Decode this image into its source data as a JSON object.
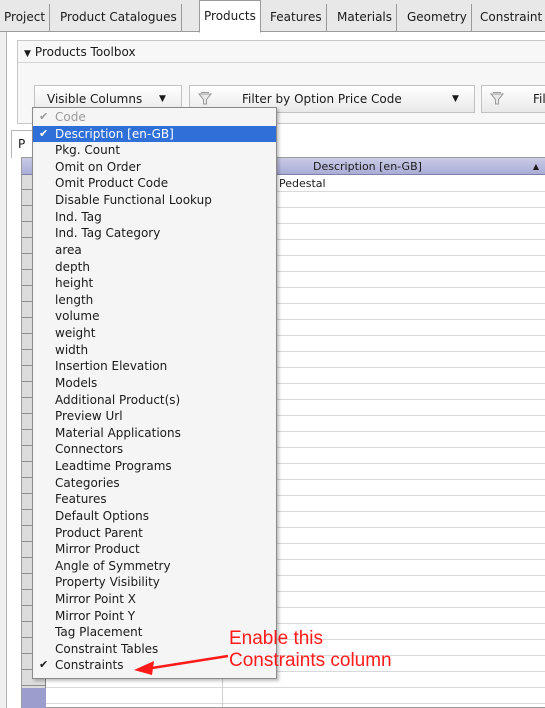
{
  "tabs": [
    "Project",
    "Product Catalogues",
    "Products",
    "Features",
    "Materials",
    "Geometry",
    "Constraint"
  ],
  "toolbox": {
    "title": "Products Toolbox",
    "visible_columns_label": "Visible Columns",
    "filter_price_code_label": "Filter by Option Price Code",
    "filter_truncated_label": "Filt"
  },
  "subtab_label": "P",
  "grid": {
    "column_header": "Description [en-GB]",
    "first_cell": "Pedestal"
  },
  "menu": {
    "items": [
      {
        "label": "Code",
        "checked": true,
        "state": "disabled"
      },
      {
        "label": "Description [en-GB]",
        "checked": true,
        "state": "highlighted"
      },
      {
        "label": "Pkg. Count",
        "checked": false
      },
      {
        "label": "Omit on Order",
        "checked": false
      },
      {
        "label": "Omit Product Code",
        "checked": false
      },
      {
        "label": "Disable Functional Lookup",
        "checked": false
      },
      {
        "label": "Ind. Tag",
        "checked": false
      },
      {
        "label": "Ind. Tag Category",
        "checked": false
      },
      {
        "label": "area",
        "checked": false
      },
      {
        "label": "depth",
        "checked": false
      },
      {
        "label": "height",
        "checked": false
      },
      {
        "label": "length",
        "checked": false
      },
      {
        "label": "volume",
        "checked": false
      },
      {
        "label": "weight",
        "checked": false
      },
      {
        "label": "width",
        "checked": false
      },
      {
        "label": "Insertion Elevation",
        "checked": false
      },
      {
        "label": "Models",
        "checked": false
      },
      {
        "label": "Additional Product(s)",
        "checked": false
      },
      {
        "label": "Preview Url",
        "checked": false
      },
      {
        "label": "Material Applications",
        "checked": false
      },
      {
        "label": "Connectors",
        "checked": false
      },
      {
        "label": "Leadtime Programs",
        "checked": false
      },
      {
        "label": "Categories",
        "checked": false
      },
      {
        "label": "Features",
        "checked": false
      },
      {
        "label": "Default Options",
        "checked": false
      },
      {
        "label": "Product Parent",
        "checked": false
      },
      {
        "label": "Mirror Product",
        "checked": false
      },
      {
        "label": "Angle of Symmetry",
        "checked": false
      },
      {
        "label": "Property Visibility",
        "checked": false
      },
      {
        "label": "Mirror Point X",
        "checked": false
      },
      {
        "label": "Mirror Point Y",
        "checked": false
      },
      {
        "label": "Tag Placement",
        "checked": false
      },
      {
        "label": "Constraint Tables",
        "checked": false
      },
      {
        "label": "Constraints",
        "checked": true
      }
    ]
  },
  "annotation": {
    "line1": "Enable this",
    "line2": "Constraints column",
    "color": "#ff1a1a"
  },
  "colors": {
    "menu_highlight": "#2f6fd8",
    "grid_header": "#a9add6"
  }
}
